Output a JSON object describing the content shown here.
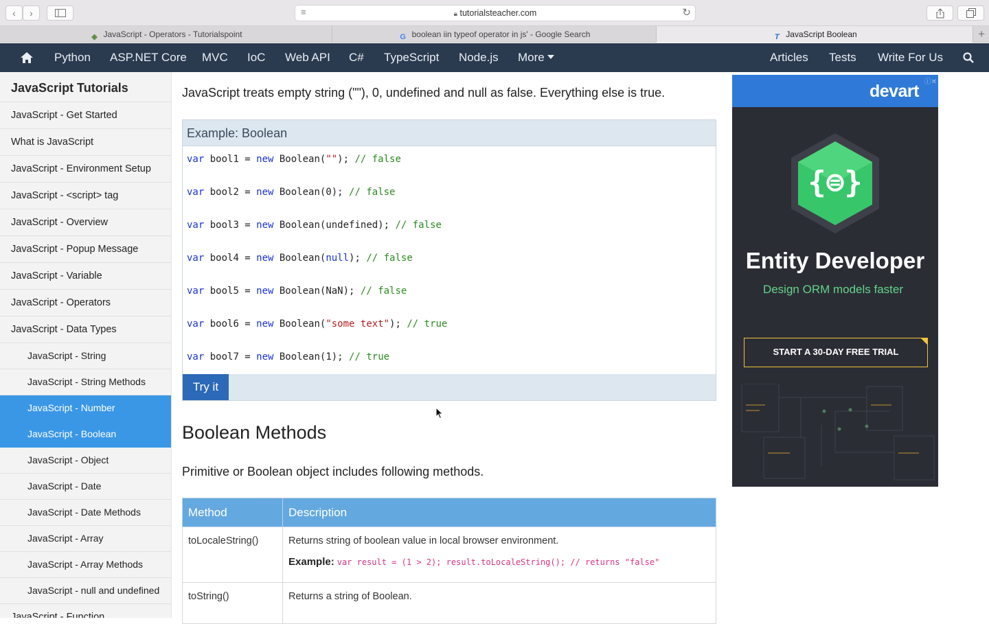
{
  "browser": {
    "url_host": "tutorialsteacher.com",
    "tabs": [
      {
        "title": "JavaScript - Operators - Tutorialspoint",
        "active": false
      },
      {
        "title": "boolean iin typeof operator in js' - Google Search",
        "active": false
      },
      {
        "title": "JavaScript Boolean",
        "active": true
      }
    ]
  },
  "nav": {
    "items": [
      "Python",
      "ASP.NET Core",
      "MVC",
      "IoC",
      "Web API",
      "C#",
      "TypeScript",
      "Node.js",
      "More"
    ],
    "right_items": [
      "Articles",
      "Tests",
      "Write For Us"
    ]
  },
  "sidebar": {
    "title": "JavaScript Tutorials",
    "items": [
      "JavaScript - Get Started",
      "What is JavaScript",
      "JavaScript - Environment Setup",
      "JavaScript - <script> tag",
      "JavaScript - Overview",
      "JavaScript - Popup Message",
      "JavaScript - Variable",
      "JavaScript - Operators",
      "JavaScript - Data Types"
    ],
    "sub_items": [
      {
        "label": "JavaScript - String",
        "active": false
      },
      {
        "label": "JavaScript - String Methods",
        "active": false
      },
      {
        "label": "JavaScript - Number",
        "active": true
      },
      {
        "label": "JavaScript - Boolean",
        "active": true
      },
      {
        "label": "JavaScript - Object",
        "active": false
      },
      {
        "label": "JavaScript - Date",
        "active": false
      },
      {
        "label": "JavaScript - Date Methods",
        "active": false
      },
      {
        "label": "JavaScript - Array",
        "active": false
      },
      {
        "label": "JavaScript - Array Methods",
        "active": false
      },
      {
        "label": "JavaScript - null and undefined",
        "active": false
      }
    ],
    "next_item": "JavaScript - Function"
  },
  "content": {
    "intro": "JavaScript treats empty string (\"\"), 0, undefined and null as false. Everything else is true.",
    "example_title": "Example: Boolean",
    "code_lines": [
      {
        "name": "bool1",
        "arg": "\"\"",
        "arg_type": "string",
        "comment": "// false"
      },
      {
        "name": "bool2",
        "arg": "0",
        "arg_type": "plain",
        "comment": "// false"
      },
      {
        "name": "bool3",
        "arg": "undefined",
        "arg_type": "plain",
        "comment": "// false"
      },
      {
        "name": "bool4",
        "arg": "null",
        "arg_type": "keyword",
        "comment": "// false"
      },
      {
        "name": "bool5",
        "arg": "NaN",
        "arg_type": "plain",
        "comment": "// false"
      },
      {
        "name": "bool6",
        "arg": "\"some text\"",
        "arg_type": "string",
        "comment": "// true"
      },
      {
        "name": "bool7",
        "arg": "1",
        "arg_type": "plain",
        "comment": "// true"
      }
    ],
    "try_label": "Try it",
    "methods_heading": "Boolean Methods",
    "methods_intro": "Primitive or Boolean object includes following methods.",
    "table_headers": [
      "Method",
      "Description"
    ],
    "table_rows": [
      {
        "method": "toLocaleString()",
        "description": "Returns string of boolean value in local browser environment.",
        "example_label": "Example:",
        "example_code": "var result = (1 > 2); result.toLocaleString(); // returns \"false\""
      },
      {
        "method": "toString()",
        "description": "Returns a string of Boolean."
      }
    ]
  },
  "ad": {
    "brand": "devart",
    "title": "Entity Developer",
    "subtitle": "Design ORM models faster",
    "cta": "START A 30-DAY FREE TRIAL",
    "accent": "#64d48a",
    "cta_border": "#f2c53d"
  },
  "colors": {
    "nav_bg": "#2a3a4f",
    "sidebar_active": "#3a97e6",
    "table_header": "#64a8e0",
    "try_button": "#2c69b8"
  }
}
